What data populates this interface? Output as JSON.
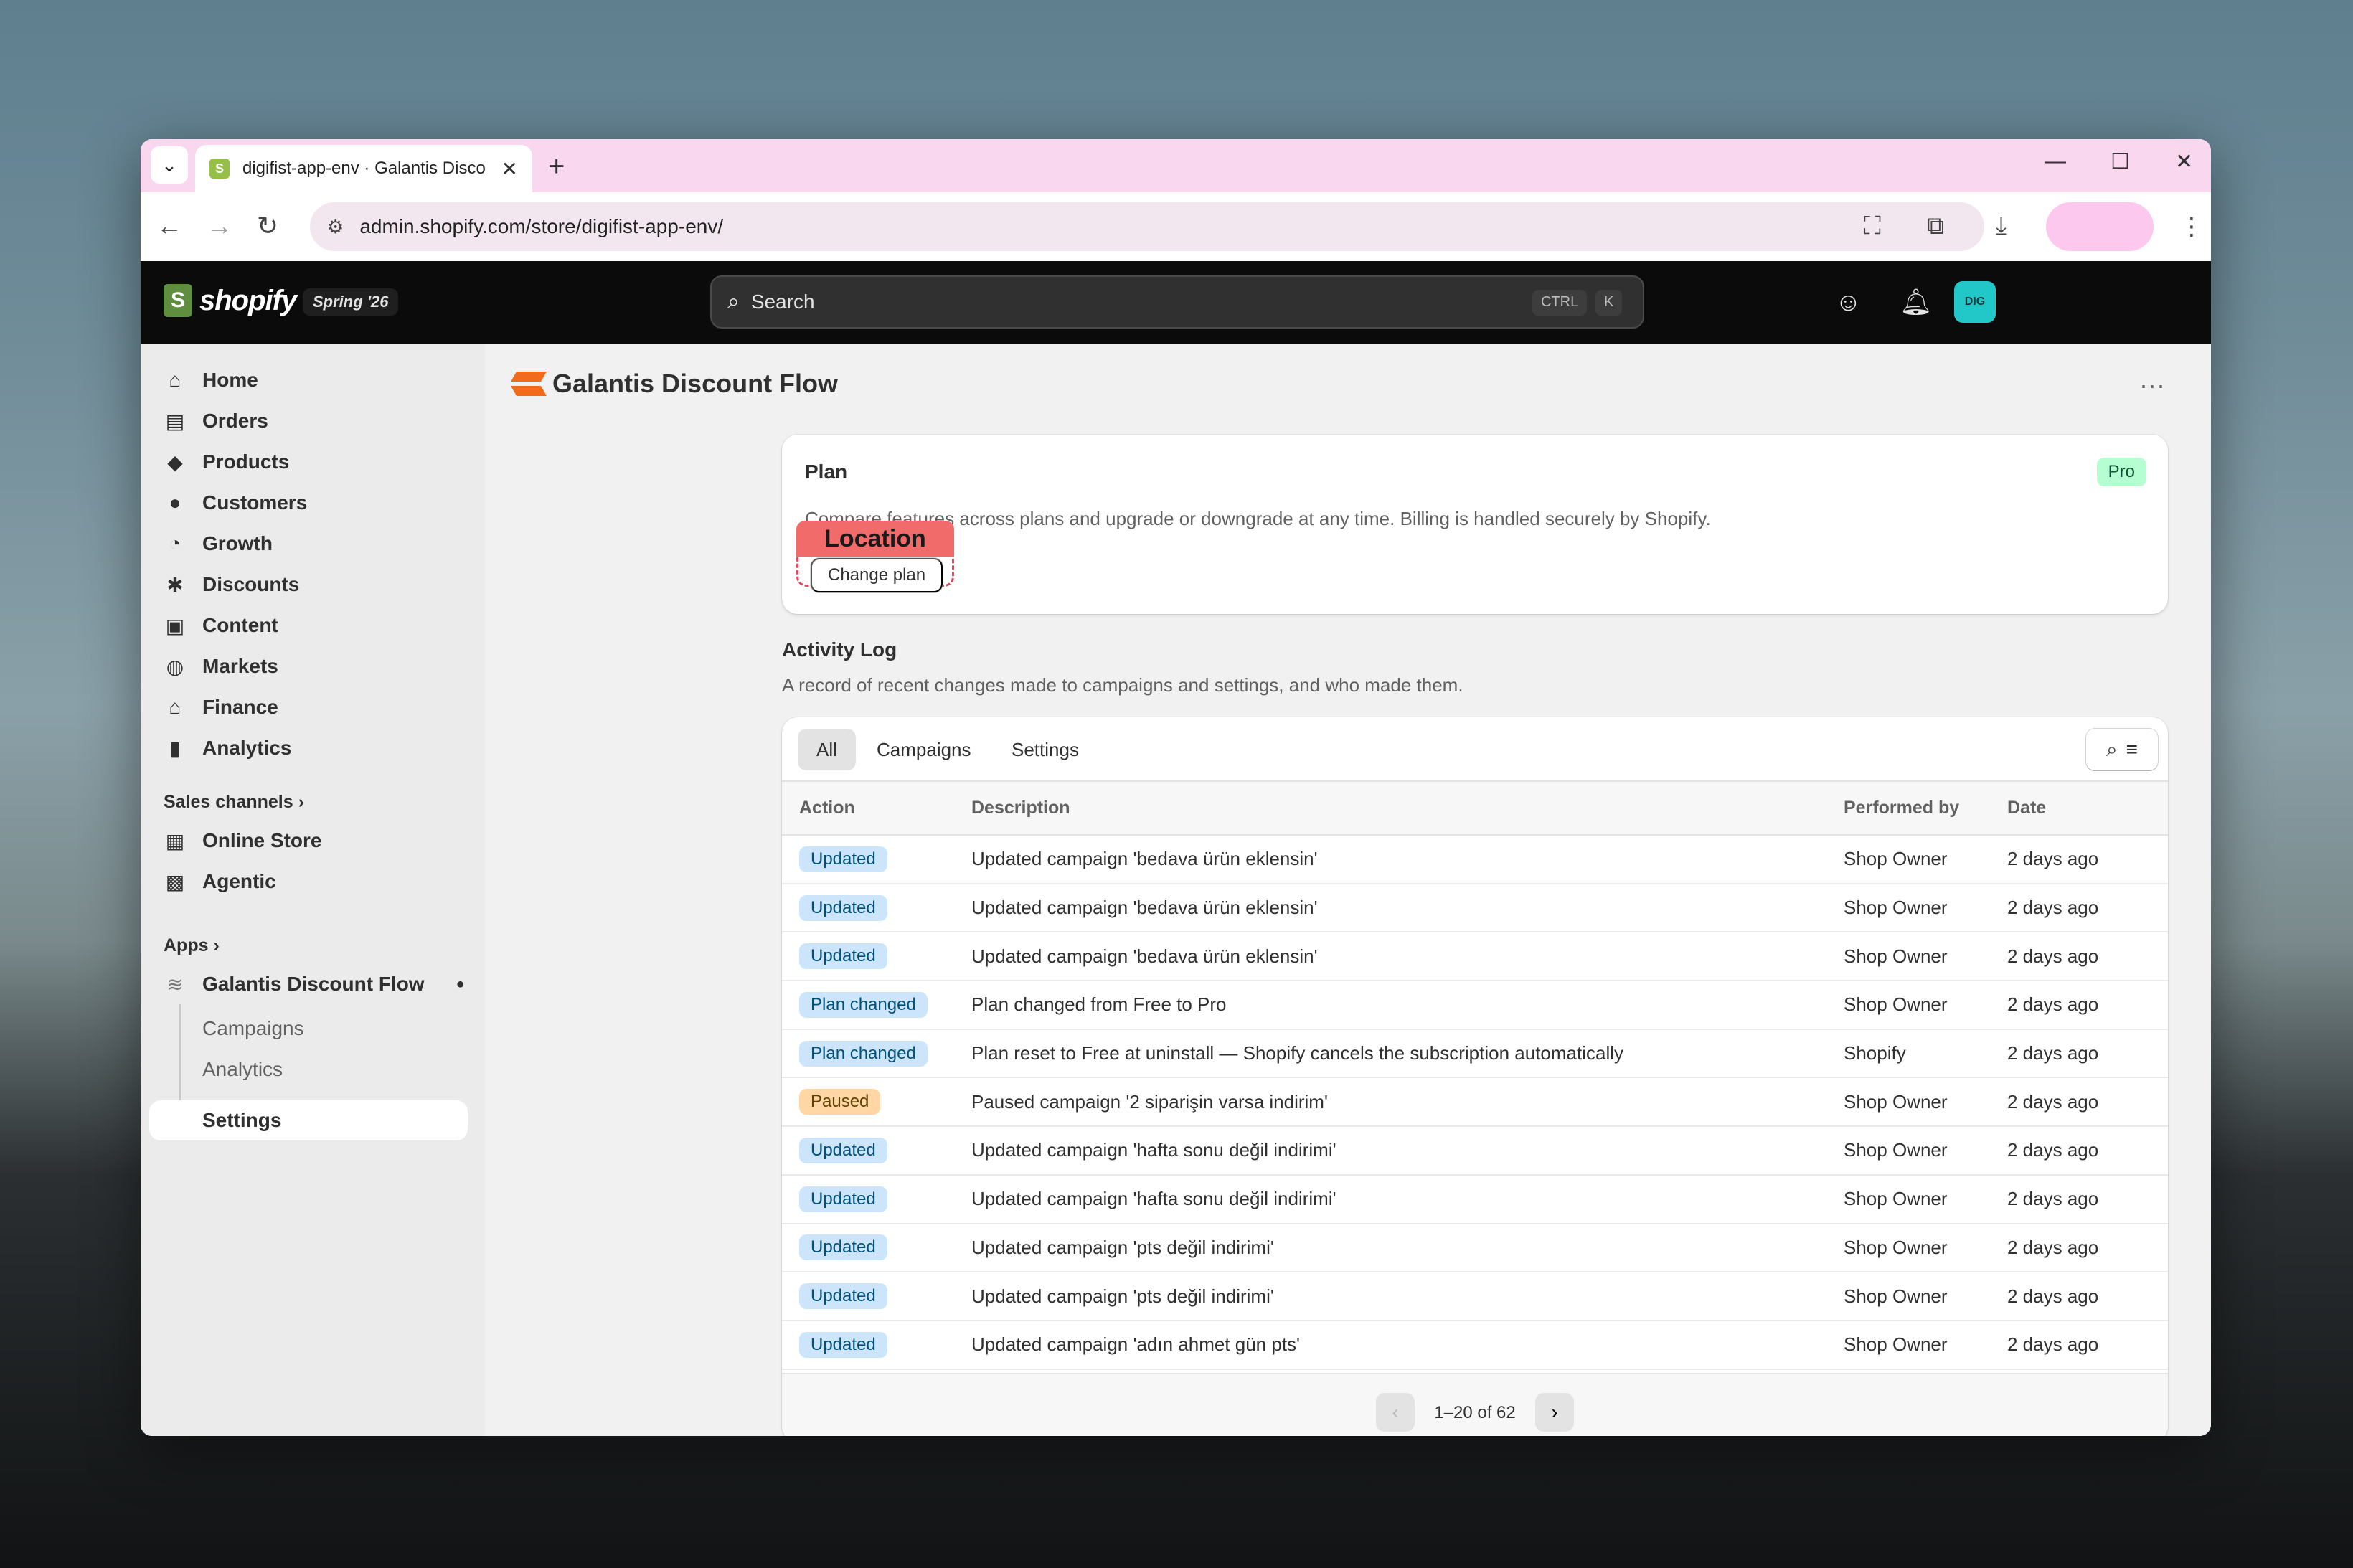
{
  "browser": {
    "tab_title": "digifist-app-env · Galantis Disco",
    "url": "admin.shopify.com/store/digifist-app-env/"
  },
  "topbar": {
    "logo_text": "shopify",
    "edition": "Spring '26",
    "search_label": "Search",
    "kbd_ctrl": "CTRL",
    "kbd_k": "K",
    "avatar": "DIG"
  },
  "sidebar": {
    "items": [
      {
        "label": "Home",
        "icon": "home-icon"
      },
      {
        "label": "Orders",
        "icon": "orders-icon"
      },
      {
        "label": "Products",
        "icon": "tag-icon"
      },
      {
        "label": "Customers",
        "icon": "person-icon"
      },
      {
        "label": "Growth",
        "icon": "gauge-icon"
      },
      {
        "label": "Discounts",
        "icon": "discount-icon"
      },
      {
        "label": "Content",
        "icon": "content-icon"
      },
      {
        "label": "Markets",
        "icon": "globe-icon"
      },
      {
        "label": "Finance",
        "icon": "bank-icon"
      },
      {
        "label": "Analytics",
        "icon": "bar-chart-icon"
      }
    ],
    "sales_channels_label": "Sales channels",
    "channels": [
      {
        "label": "Online Store"
      },
      {
        "label": "Agentic"
      }
    ],
    "apps_label": "Apps",
    "app_name": "Galantis Discount Flow",
    "app_subitems": [
      "Campaigns",
      "Analytics",
      "Settings"
    ],
    "bottom_settings": "S"
  },
  "main": {
    "app_title": "Galantis Discount Flow",
    "plan": {
      "title": "Plan",
      "badge": "Pro",
      "description": "Compare features across plans and upgrade or downgrade at any time. Billing is handled securely by Shopify.",
      "button": "Change plan",
      "overlay_label": "Location"
    },
    "activity": {
      "title": "Activity Log",
      "description": "A record of recent changes made to campaigns and settings, and who made them.",
      "tabs": [
        "All",
        "Campaigns",
        "Settings"
      ],
      "columns": [
        "Action",
        "Description",
        "Performed by",
        "Date"
      ],
      "rows": [
        {
          "action": "Updated",
          "tone": "info",
          "description": "Updated campaign 'bedava ürün eklensin'",
          "by": "Shop Owner",
          "date": "2 days ago"
        },
        {
          "action": "Updated",
          "tone": "info",
          "description": "Updated campaign 'bedava ürün eklensin'",
          "by": "Shop Owner",
          "date": "2 days ago"
        },
        {
          "action": "Updated",
          "tone": "info",
          "description": "Updated campaign 'bedava ürün eklensin'",
          "by": "Shop Owner",
          "date": "2 days ago"
        },
        {
          "action": "Plan changed",
          "tone": "info",
          "description": "Plan changed from Free to Pro",
          "by": "Shop Owner",
          "date": "2 days ago"
        },
        {
          "action": "Plan changed",
          "tone": "info",
          "description": "Plan reset to Free at uninstall — Shopify cancels the subscription automatically",
          "by": "Shopify",
          "date": "2 days ago"
        },
        {
          "action": "Paused",
          "tone": "warn",
          "description": "Paused campaign '2 siparişin varsa indirim'",
          "by": "Shop Owner",
          "date": "2 days ago"
        },
        {
          "action": "Updated",
          "tone": "info",
          "description": "Updated campaign 'hafta sonu değil indirimi'",
          "by": "Shop Owner",
          "date": "2 days ago"
        },
        {
          "action": "Updated",
          "tone": "info",
          "description": "Updated campaign 'hafta sonu değil indirimi'",
          "by": "Shop Owner",
          "date": "2 days ago"
        },
        {
          "action": "Updated",
          "tone": "info",
          "description": "Updated campaign 'pts değil indirimi'",
          "by": "Shop Owner",
          "date": "2 days ago"
        },
        {
          "action": "Updated",
          "tone": "info",
          "description": "Updated campaign 'pts değil indirimi'",
          "by": "Shop Owner",
          "date": "2 days ago"
        },
        {
          "action": "Updated",
          "tone": "info",
          "description": "Updated campaign 'adın ahmet gün pts'",
          "by": "Shop Owner",
          "date": "2 days ago"
        }
      ],
      "pagination": "1–20 of 62"
    }
  }
}
